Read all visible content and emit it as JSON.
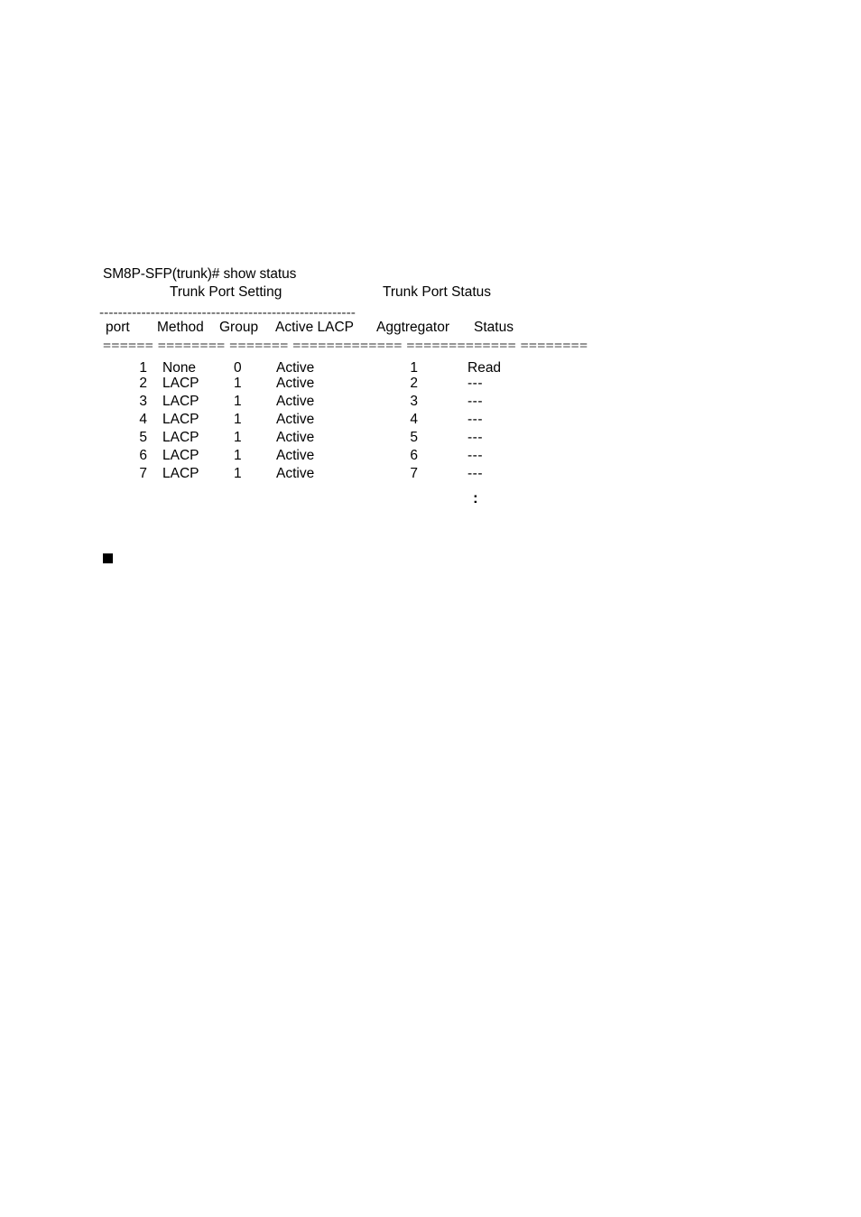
{
  "terminal": {
    "prompt_line": "SM8P-SFP(trunk)# show status",
    "section_titles": {
      "left": "Trunk Port Setting",
      "right": "Trunk Port Status"
    },
    "dashed_separator": "-------------------------------------------------------",
    "equals_separator": "====== ======== ======= ============= ============= ========",
    "columns": [
      "port",
      "Method",
      "Group",
      "Active LACP",
      "Aggtregator",
      "Status"
    ],
    "rows": [
      {
        "port": "1",
        "method": "None",
        "group": "0",
        "active_lacp": "Active",
        "aggregator": "1",
        "status": "Read"
      },
      {
        "port": "2",
        "method": "LACP",
        "group": "1",
        "active_lacp": "Active",
        "aggregator": "2",
        "status": "---"
      },
      {
        "port": "3",
        "method": "LACP",
        "group": "1",
        "active_lacp": "Active",
        "aggregator": "3",
        "status": "---"
      },
      {
        "port": "4",
        "method": "LACP",
        "group": "1",
        "active_lacp": "Active",
        "aggregator": "4",
        "status": "---"
      },
      {
        "port": "5",
        "method": "LACP",
        "group": "1",
        "active_lacp": "Active",
        "aggregator": "5",
        "status": "---"
      },
      {
        "port": "6",
        "method": "LACP",
        "group": "1",
        "active_lacp": "Active",
        "aggregator": "6",
        "status": "---"
      },
      {
        "port": "7",
        "method": "LACP",
        "group": "1",
        "active_lacp": "Active",
        "aggregator": "7",
        "status": "---"
      }
    ],
    "continuation_marker": ":"
  },
  "body": {
    "bullet_marker": ""
  },
  "colors": {
    "page_background": "#ffffff",
    "text": "#000000",
    "rule": "#1a1a1a"
  }
}
